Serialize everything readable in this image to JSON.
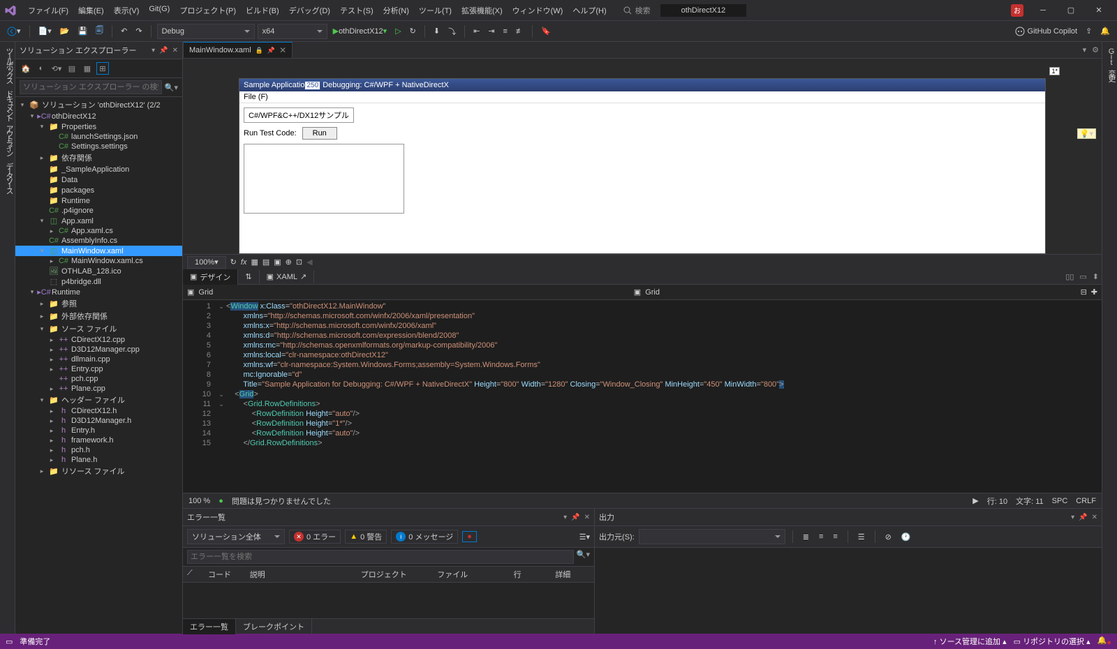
{
  "title": "othDirectX12",
  "menus": [
    "ファイル(F)",
    "編集(E)",
    "表示(V)",
    "Git(G)",
    "プロジェクト(P)",
    "ビルド(B)",
    "デバッグ(D)",
    "テスト(S)",
    "分析(N)",
    "ツール(T)",
    "拡張機能(X)",
    "ウィンドウ(W)",
    "ヘルプ(H)"
  ],
  "search_placeholder": "検索",
  "config": "Debug",
  "platform": "x64",
  "run_label": "othDirectX12",
  "copilot": "GitHub Copilot",
  "left_rail": [
    "ツールボックス",
    "ドキュメント アウトライン",
    "データソース"
  ],
  "right_rail": [
    "Git 変更"
  ],
  "explorer": {
    "title": "ソリューション エクスプローラー",
    "search": "ソリューション エクスプローラー の検索",
    "items": [
      {
        "d": 0,
        "c": "▾",
        "i": "sln",
        "t": "ソリューション 'othDirectX12' (2/2"
      },
      {
        "d": 1,
        "c": "▾",
        "i": "proj",
        "t": "othDirectX12"
      },
      {
        "d": 2,
        "c": "▾",
        "i": "fold",
        "t": "Properties"
      },
      {
        "d": 3,
        "c": "",
        "i": "cs",
        "t": "launchSettings.json"
      },
      {
        "d": 3,
        "c": "",
        "i": "cs",
        "t": "Settings.settings"
      },
      {
        "d": 2,
        "c": "▸",
        "i": "fold",
        "t": "依存関係"
      },
      {
        "d": 2,
        "c": "",
        "i": "fold",
        "t": "_SampleApplication"
      },
      {
        "d": 2,
        "c": "",
        "i": "fold",
        "t": "Data"
      },
      {
        "d": 2,
        "c": "",
        "i": "fold",
        "t": "packages"
      },
      {
        "d": 2,
        "c": "",
        "i": "fold",
        "t": "Runtime"
      },
      {
        "d": 2,
        "c": "",
        "i": "cs",
        "t": ".p4ignore"
      },
      {
        "d": 2,
        "c": "▾",
        "i": "xaml",
        "t": "App.xaml"
      },
      {
        "d": 3,
        "c": "▸",
        "i": "cs",
        "t": "App.xaml.cs"
      },
      {
        "d": 2,
        "c": "",
        "i": "cs",
        "t": "AssemblyInfo.cs"
      },
      {
        "d": 2,
        "c": "▾",
        "i": "xaml",
        "t": "MainWindow.xaml",
        "sel": true
      },
      {
        "d": 3,
        "c": "▸",
        "i": "cs",
        "t": "MainWindow.xaml.cs"
      },
      {
        "d": 2,
        "c": "",
        "i": "ico",
        "t": "OTHLAB_128.ico"
      },
      {
        "d": 2,
        "c": "",
        "i": "dll",
        "t": "p4bridge.dll"
      },
      {
        "d": 1,
        "c": "▾",
        "i": "proj",
        "t": "Runtime"
      },
      {
        "d": 2,
        "c": "▸",
        "i": "fold",
        "t": "参照"
      },
      {
        "d": 2,
        "c": "▸",
        "i": "fold",
        "t": "外部依存関係"
      },
      {
        "d": 2,
        "c": "▾",
        "i": "fold",
        "t": "ソース ファイル"
      },
      {
        "d": 3,
        "c": "▸",
        "i": "cpp",
        "t": "CDirectX12.cpp"
      },
      {
        "d": 3,
        "c": "▸",
        "i": "cpp",
        "t": "D3D12Manager.cpp"
      },
      {
        "d": 3,
        "c": "▸",
        "i": "cpp",
        "t": "dllmain.cpp"
      },
      {
        "d": 3,
        "c": "▸",
        "i": "cpp",
        "t": "Entry.cpp"
      },
      {
        "d": 3,
        "c": "",
        "i": "cpp",
        "t": "pch.cpp"
      },
      {
        "d": 3,
        "c": "▸",
        "i": "cpp",
        "t": "Plane.cpp"
      },
      {
        "d": 2,
        "c": "▾",
        "i": "fold",
        "t": "ヘッダー ファイル"
      },
      {
        "d": 3,
        "c": "▸",
        "i": "h",
        "t": "CDirectX12.h"
      },
      {
        "d": 3,
        "c": "▸",
        "i": "h",
        "t": "D3D12Manager.h"
      },
      {
        "d": 3,
        "c": "▸",
        "i": "h",
        "t": "Entry.h"
      },
      {
        "d": 3,
        "c": "▸",
        "i": "h",
        "t": "framework.h"
      },
      {
        "d": 3,
        "c": "▸",
        "i": "h",
        "t": "pch.h"
      },
      {
        "d": 3,
        "c": "▸",
        "i": "h",
        "t": "Plane.h"
      },
      {
        "d": 2,
        "c": "▸",
        "i": "fold",
        "t": "リソース ファイル"
      }
    ]
  },
  "tab_name": "MainWindow.xaml",
  "app": {
    "title_prefix": "Sample Applicatio",
    "badge": "250",
    "title_suffix": " Debugging: C#/WPF + NativeDirectX",
    "menu": "File (F)",
    "text1": "C#/WPF&C++/DX12サンプル",
    "run_label": "Run Test Code:",
    "run_btn": "Run"
  },
  "zoom": "100%",
  "split_design": "デザイン",
  "split_xaml": "XAML",
  "breadcrumb": "Grid",
  "code_lines": [
    1,
    2,
    3,
    4,
    5,
    6,
    7,
    8,
    9,
    10,
    11,
    12,
    13,
    14,
    15
  ],
  "ed_status": {
    "zoom": "100 %",
    "msg": "問題は見つかりませんでした",
    "pos": "行: 10",
    "col": "文字: 11",
    "ins": "SPC",
    "eol": "CRLF"
  },
  "errors": {
    "title": "エラー一覧",
    "scope": "ソリューション全体",
    "e0": "0 エラー",
    "w0": "0 警告",
    "m0": "0 メッセージ",
    "search": "エラー一覧を検索",
    "cols": [
      "コード",
      "説明",
      "プロジェクト",
      "ファイル",
      "行",
      "詳細"
    ],
    "tabs": [
      "エラー一覧",
      "ブレークポイント"
    ]
  },
  "output": {
    "title": "出力",
    "src_label": "出力元(S):"
  },
  "status": {
    "left": "準備完了",
    "mid": "ソース管理に追加",
    "right": "リポジトリの選択"
  }
}
